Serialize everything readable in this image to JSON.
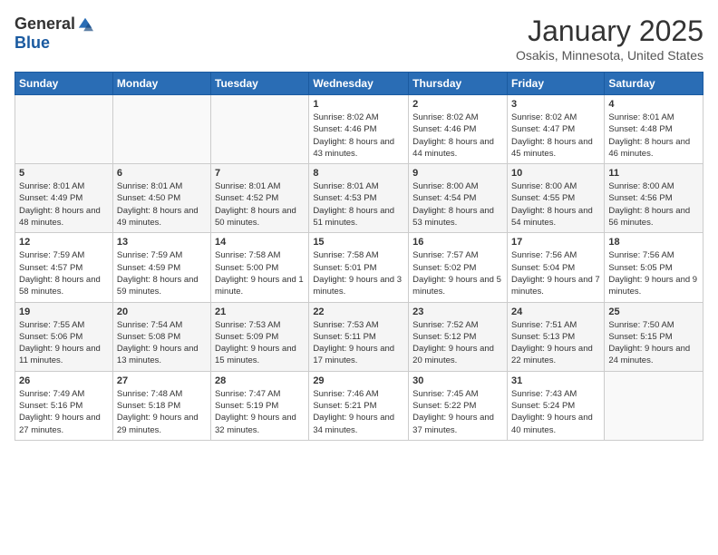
{
  "logo": {
    "general": "General",
    "blue": "Blue"
  },
  "header": {
    "month": "January 2025",
    "location": "Osakis, Minnesota, United States"
  },
  "weekdays": [
    "Sunday",
    "Monday",
    "Tuesday",
    "Wednesday",
    "Thursday",
    "Friday",
    "Saturday"
  ],
  "weeks": [
    [
      {
        "day": "",
        "info": ""
      },
      {
        "day": "",
        "info": ""
      },
      {
        "day": "",
        "info": ""
      },
      {
        "day": "1",
        "info": "Sunrise: 8:02 AM\nSunset: 4:46 PM\nDaylight: 8 hours and 43 minutes."
      },
      {
        "day": "2",
        "info": "Sunrise: 8:02 AM\nSunset: 4:46 PM\nDaylight: 8 hours and 44 minutes."
      },
      {
        "day": "3",
        "info": "Sunrise: 8:02 AM\nSunset: 4:47 PM\nDaylight: 8 hours and 45 minutes."
      },
      {
        "day": "4",
        "info": "Sunrise: 8:01 AM\nSunset: 4:48 PM\nDaylight: 8 hours and 46 minutes."
      }
    ],
    [
      {
        "day": "5",
        "info": "Sunrise: 8:01 AM\nSunset: 4:49 PM\nDaylight: 8 hours and 48 minutes."
      },
      {
        "day": "6",
        "info": "Sunrise: 8:01 AM\nSunset: 4:50 PM\nDaylight: 8 hours and 49 minutes."
      },
      {
        "day": "7",
        "info": "Sunrise: 8:01 AM\nSunset: 4:52 PM\nDaylight: 8 hours and 50 minutes."
      },
      {
        "day": "8",
        "info": "Sunrise: 8:01 AM\nSunset: 4:53 PM\nDaylight: 8 hours and 51 minutes."
      },
      {
        "day": "9",
        "info": "Sunrise: 8:00 AM\nSunset: 4:54 PM\nDaylight: 8 hours and 53 minutes."
      },
      {
        "day": "10",
        "info": "Sunrise: 8:00 AM\nSunset: 4:55 PM\nDaylight: 8 hours and 54 minutes."
      },
      {
        "day": "11",
        "info": "Sunrise: 8:00 AM\nSunset: 4:56 PM\nDaylight: 8 hours and 56 minutes."
      }
    ],
    [
      {
        "day": "12",
        "info": "Sunrise: 7:59 AM\nSunset: 4:57 PM\nDaylight: 8 hours and 58 minutes."
      },
      {
        "day": "13",
        "info": "Sunrise: 7:59 AM\nSunset: 4:59 PM\nDaylight: 8 hours and 59 minutes."
      },
      {
        "day": "14",
        "info": "Sunrise: 7:58 AM\nSunset: 5:00 PM\nDaylight: 9 hours and 1 minute."
      },
      {
        "day": "15",
        "info": "Sunrise: 7:58 AM\nSunset: 5:01 PM\nDaylight: 9 hours and 3 minutes."
      },
      {
        "day": "16",
        "info": "Sunrise: 7:57 AM\nSunset: 5:02 PM\nDaylight: 9 hours and 5 minutes."
      },
      {
        "day": "17",
        "info": "Sunrise: 7:56 AM\nSunset: 5:04 PM\nDaylight: 9 hours and 7 minutes."
      },
      {
        "day": "18",
        "info": "Sunrise: 7:56 AM\nSunset: 5:05 PM\nDaylight: 9 hours and 9 minutes."
      }
    ],
    [
      {
        "day": "19",
        "info": "Sunrise: 7:55 AM\nSunset: 5:06 PM\nDaylight: 9 hours and 11 minutes."
      },
      {
        "day": "20",
        "info": "Sunrise: 7:54 AM\nSunset: 5:08 PM\nDaylight: 9 hours and 13 minutes."
      },
      {
        "day": "21",
        "info": "Sunrise: 7:53 AM\nSunset: 5:09 PM\nDaylight: 9 hours and 15 minutes."
      },
      {
        "day": "22",
        "info": "Sunrise: 7:53 AM\nSunset: 5:11 PM\nDaylight: 9 hours and 17 minutes."
      },
      {
        "day": "23",
        "info": "Sunrise: 7:52 AM\nSunset: 5:12 PM\nDaylight: 9 hours and 20 minutes."
      },
      {
        "day": "24",
        "info": "Sunrise: 7:51 AM\nSunset: 5:13 PM\nDaylight: 9 hours and 22 minutes."
      },
      {
        "day": "25",
        "info": "Sunrise: 7:50 AM\nSunset: 5:15 PM\nDaylight: 9 hours and 24 minutes."
      }
    ],
    [
      {
        "day": "26",
        "info": "Sunrise: 7:49 AM\nSunset: 5:16 PM\nDaylight: 9 hours and 27 minutes."
      },
      {
        "day": "27",
        "info": "Sunrise: 7:48 AM\nSunset: 5:18 PM\nDaylight: 9 hours and 29 minutes."
      },
      {
        "day": "28",
        "info": "Sunrise: 7:47 AM\nSunset: 5:19 PM\nDaylight: 9 hours and 32 minutes."
      },
      {
        "day": "29",
        "info": "Sunrise: 7:46 AM\nSunset: 5:21 PM\nDaylight: 9 hours and 34 minutes."
      },
      {
        "day": "30",
        "info": "Sunrise: 7:45 AM\nSunset: 5:22 PM\nDaylight: 9 hours and 37 minutes."
      },
      {
        "day": "31",
        "info": "Sunrise: 7:43 AM\nSunset: 5:24 PM\nDaylight: 9 hours and 40 minutes."
      },
      {
        "day": "",
        "info": ""
      }
    ]
  ]
}
